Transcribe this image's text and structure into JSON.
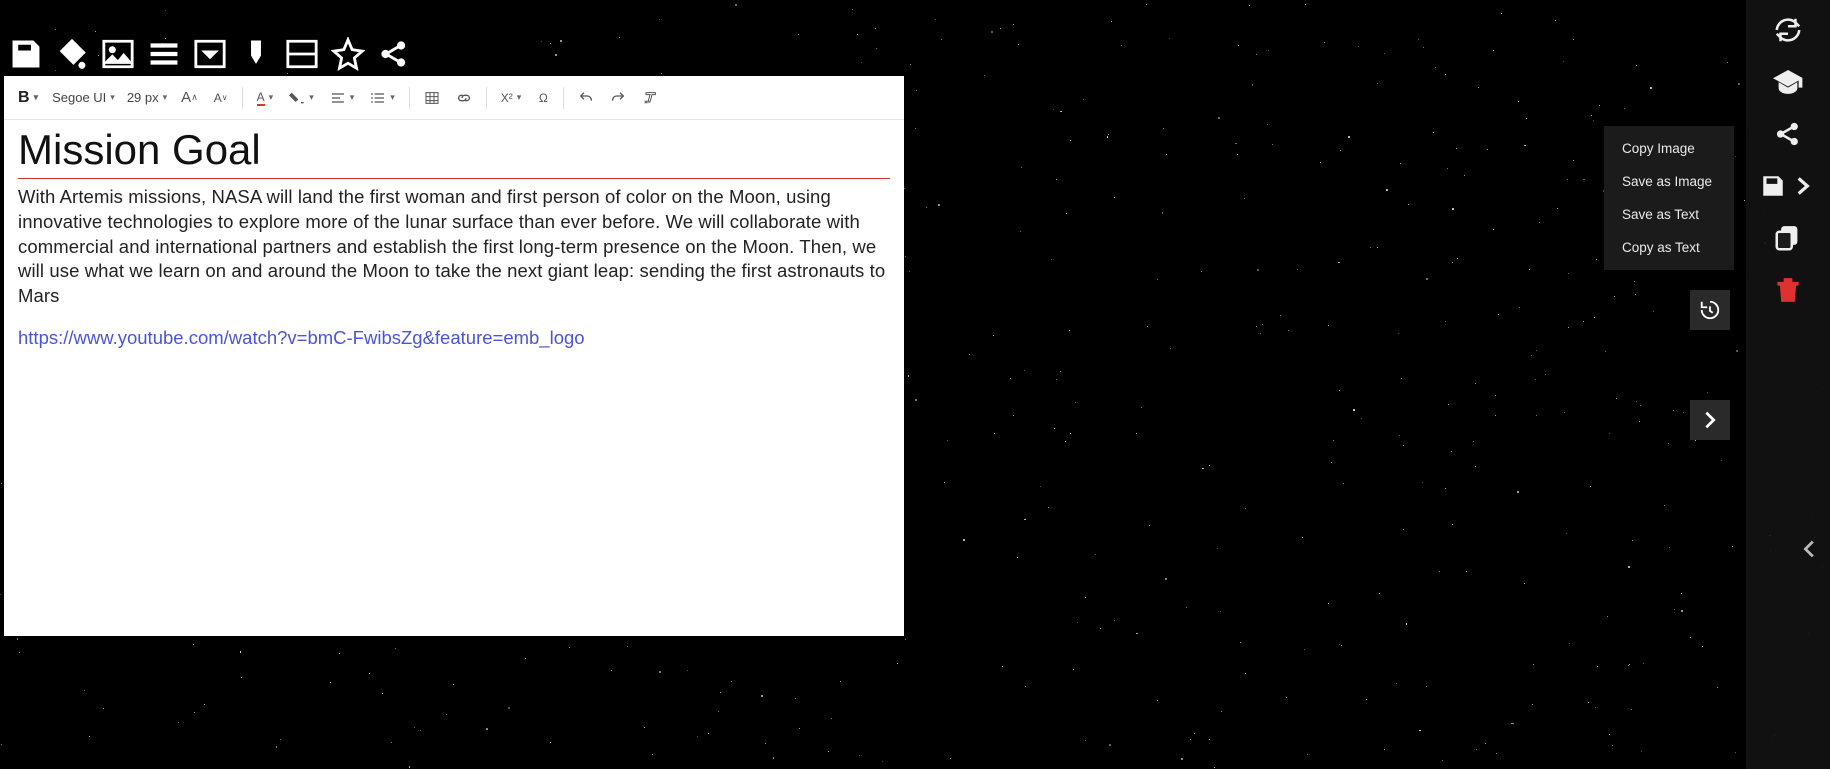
{
  "editor": {
    "font_name": "Segoe UI",
    "font_size": "29 px",
    "superscript_label": "X²"
  },
  "document": {
    "title": "Mission Goal",
    "body": "With Artemis missions, NASA will land the first woman and first person of color on the Moon, using innovative technologies to explore more of the lunar surface than ever before. We will collaborate with commercial and international partners and establish the first long-term presence on the Moon. Then, we will use what we learn on and around the Moon to take the next giant leap: sending the first astronauts to Mars",
    "link": "https://www.youtube.com/watch?v=bmC-FwibsZg&feature=emb_logo"
  },
  "context_menu": {
    "items": [
      "Copy Image",
      "Save as Image",
      "Save as Text",
      "Copy as Text"
    ]
  }
}
